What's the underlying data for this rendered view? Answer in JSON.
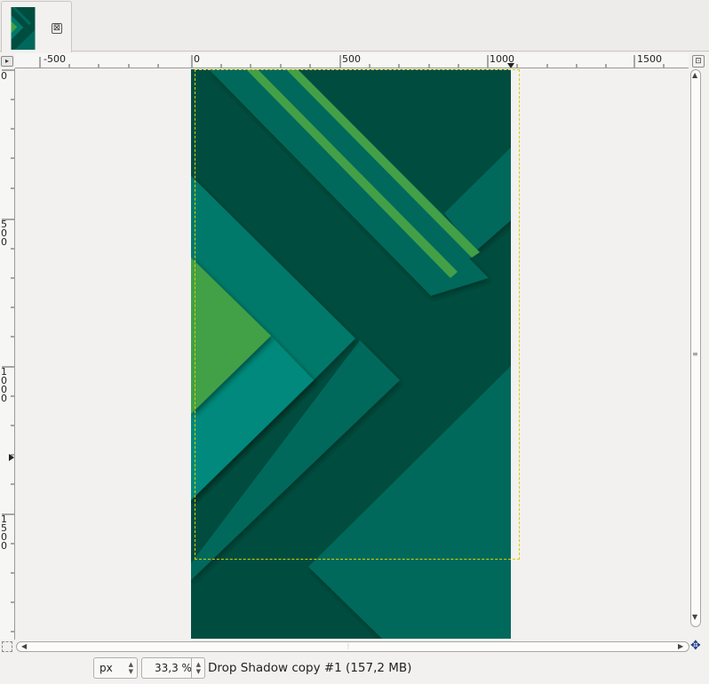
{
  "tab": {
    "close_icon": "close-icon",
    "close_glyph": "⊠"
  },
  "rulers": {
    "horizontal_labels": [
      "-500",
      "0",
      "500",
      "1000",
      "1500"
    ],
    "vertical_labels": [
      "0",
      "500",
      "1000",
      "1500"
    ]
  },
  "canvas": {
    "background_color": "#004d40",
    "colors": {
      "dark_green": "#004d40",
      "teal": "#00695c",
      "teal_mid": "#00796b",
      "teal_light": "#00897b",
      "green": "#43a047"
    }
  },
  "statusbar": {
    "unit": "px",
    "zoom": "33,3 %",
    "layer_info": "Drop Shadow copy #1 (157,2 MB)"
  }
}
